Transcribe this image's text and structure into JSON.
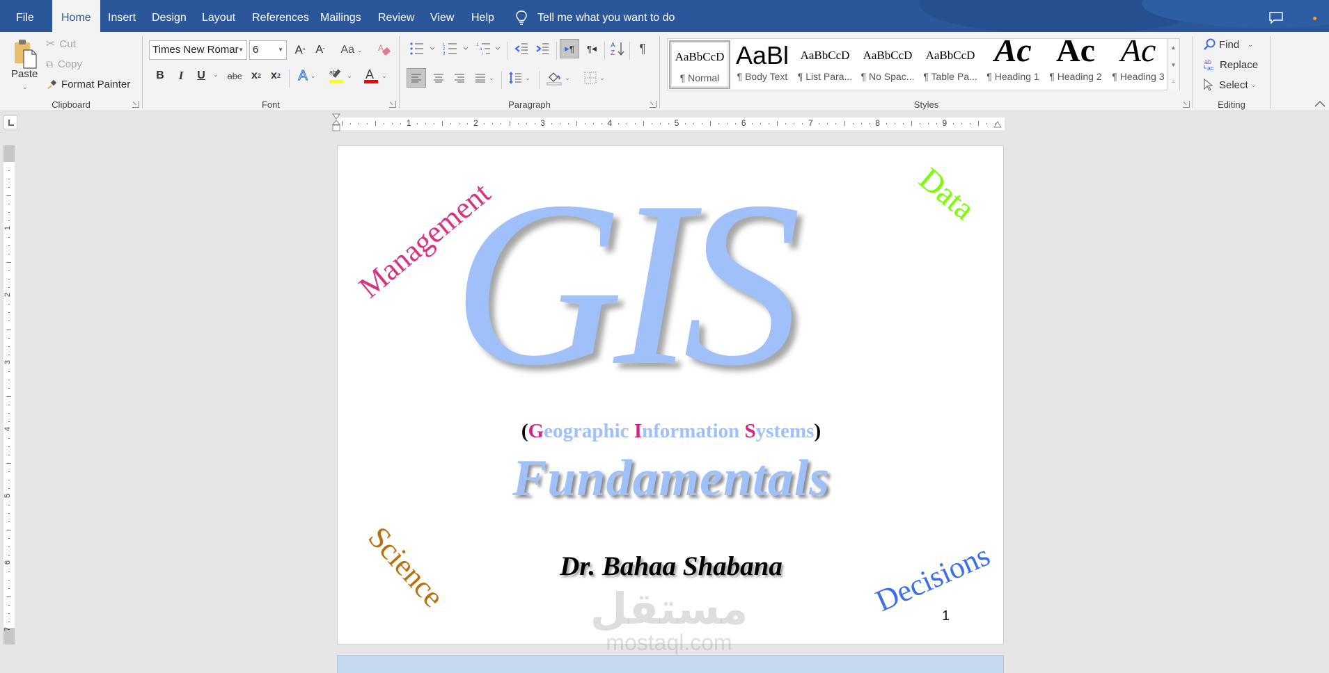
{
  "tabs": [
    {
      "label": "File",
      "active": false
    },
    {
      "label": "Home",
      "active": true
    },
    {
      "label": "Insert",
      "active": false
    },
    {
      "label": "Design",
      "active": false
    },
    {
      "label": "Layout",
      "active": false
    },
    {
      "label": "References",
      "active": false
    },
    {
      "label": "Mailings",
      "active": false
    },
    {
      "label": "Review",
      "active": false
    },
    {
      "label": "View",
      "active": false
    },
    {
      "label": "Help",
      "active": false
    }
  ],
  "tell_me": {
    "icon": "lightbulb-icon",
    "placeholder": "Tell me what you want to do"
  },
  "title_bar": {
    "comments_icon": "comment-icon",
    "accent": "#2b579a"
  },
  "ribbon": {
    "clipboard": {
      "label": "Clipboard",
      "paste": "Paste",
      "cut": "Cut",
      "copy": "Copy",
      "format_painter": "Format Painter"
    },
    "font": {
      "label": "Font",
      "font_name": "Times New Romar",
      "font_size": "6",
      "grow_icon": "A",
      "shrink_icon": "A",
      "change_case": "Aa",
      "bold": "B",
      "italic": "I",
      "underline": "U",
      "strikethrough": "abc",
      "subscript": "x",
      "superscript": "x",
      "text_effects": "A",
      "highlight_color": "#ffff00",
      "font_color_label": "A",
      "font_color": "#ff0000"
    },
    "paragraph": {
      "label": "Paragraph",
      "pilcrow": "¶"
    },
    "styles": {
      "label": "Styles",
      "items": [
        {
          "preview": "AaBbCcD",
          "name": "¶ Normal",
          "current": true
        },
        {
          "preview": "AaBl",
          "name": "¶ Body Text",
          "current": false
        },
        {
          "preview": "AaBbCcD",
          "name": "¶ List Para...",
          "current": false
        },
        {
          "preview": "AaBbCcD",
          "name": "¶ No Spac...",
          "current": false
        },
        {
          "preview": "AaBbCcD",
          "name": "¶ Table Pa...",
          "current": false
        },
        {
          "preview": "Ac",
          "name": "¶ Heading 1",
          "current": false
        },
        {
          "preview": "Ac",
          "name": "¶ Heading 2",
          "current": false
        },
        {
          "preview": "Ac",
          "name": "¶ Heading 3",
          "current": false
        }
      ]
    },
    "editing": {
      "label": "Editing",
      "find": "Find",
      "replace": "Replace",
      "select": "Select"
    }
  },
  "ruler": {
    "horizontal_numbers": [
      "1",
      "2",
      "3",
      "4",
      "5",
      "6",
      "7",
      "8",
      "9"
    ],
    "vertical_numbers": [
      "1",
      "2",
      "3",
      "4",
      "5",
      "6",
      "7"
    ]
  },
  "document": {
    "title_big": "GIS",
    "subtitle_parts": [
      {
        "text": "(",
        "kind": "paren"
      },
      {
        "text": "G",
        "kind": "init"
      },
      {
        "text": "eographic ",
        "kind": "rest"
      },
      {
        "text": "I",
        "kind": "init"
      },
      {
        "text": "nformation ",
        "kind": "rest"
      },
      {
        "text": "S",
        "kind": "init"
      },
      {
        "text": "ystems",
        "kind": "rest"
      },
      {
        "text": ")",
        "kind": "paren"
      }
    ],
    "heading": "Fundamentals",
    "author": "Dr. Bahaa Shabana",
    "page_number": "1",
    "corner_words": {
      "management": {
        "text": "Management",
        "color": "#d63384"
      },
      "data": {
        "text": "Data",
        "color": "#7cfc00"
      },
      "science": {
        "text": "Science",
        "color": "#b8700f"
      },
      "decisions": {
        "text": "Decisions",
        "color": "#3d6ee8"
      }
    },
    "colors": {
      "wordart_blue": "#9fc0f8",
      "initial_pink": "#cf2784"
    }
  },
  "watermark": {
    "arabic": "مستقل",
    "latin": "mostaql.com"
  }
}
